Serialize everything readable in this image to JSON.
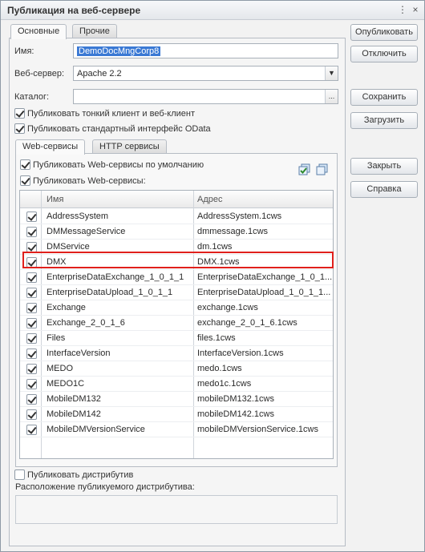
{
  "window": {
    "title": "Публикация на веб-сервере",
    "close_glyph": "×"
  },
  "tabs": [
    {
      "label": "Основные",
      "active": true
    },
    {
      "label": "Прочие",
      "active": false
    }
  ],
  "form": {
    "name_label": "Имя:",
    "name_value": "DemoDocMngCorp8",
    "server_label": "Веб-сервер:",
    "server_value": "Apache 2.2",
    "catalog_label": "Каталог:",
    "catalog_value": "",
    "catalog_btn": "...",
    "chk_thin_client": {
      "label": "Публиковать тонкий клиент и веб-клиент",
      "checked": true
    },
    "chk_odata": {
      "label": "Публиковать стандартный интерфейс OData",
      "checked": true
    }
  },
  "inner_tabs": [
    {
      "label": "Web-сервисы",
      "active": true
    },
    {
      "label": "HTTP сервисы",
      "active": false
    }
  ],
  "ws": {
    "chk_default": {
      "label": "Публиковать Web-сервисы по умолчанию",
      "checked": true
    },
    "chk_publish": {
      "label": "Публиковать Web-сервисы:",
      "checked": true
    },
    "columns": {
      "name": "Имя",
      "address": "Адрес"
    },
    "rows": [
      {
        "name": "AddressSystem",
        "address": "AddressSystem.1cws",
        "checked": true
      },
      {
        "name": "DMMessageService",
        "address": "dmmessage.1cws",
        "checked": true
      },
      {
        "name": "DMService",
        "address": "dm.1cws",
        "checked": true
      },
      {
        "name": "DMX",
        "address": "DMX.1cws",
        "checked": true
      },
      {
        "name": "EnterpriseDataExchange_1_0_1_1",
        "address": "EnterpriseDataExchange_1_0_1...",
        "checked": true
      },
      {
        "name": "EnterpriseDataUpload_1_0_1_1",
        "address": "EnterpriseDataUpload_1_0_1_1...",
        "checked": true
      },
      {
        "name": "Exchange",
        "address": "exchange.1cws",
        "checked": true
      },
      {
        "name": "Exchange_2_0_1_6",
        "address": "exchange_2_0_1_6.1cws",
        "checked": true
      },
      {
        "name": "Files",
        "address": "files.1cws",
        "checked": true
      },
      {
        "name": "InterfaceVersion",
        "address": "InterfaceVersion.1cws",
        "checked": true
      },
      {
        "name": "MEDO",
        "address": "medo.1cws",
        "checked": true
      },
      {
        "name": "MEDO1C",
        "address": "medo1c.1cws",
        "checked": true
      },
      {
        "name": "MobileDM132",
        "address": "mobileDM132.1cws",
        "checked": true
      },
      {
        "name": "MobileDM142",
        "address": "mobileDM142.1cws",
        "checked": true
      },
      {
        "name": "MobileDMVersionService",
        "address": "mobileDMVersionService.1cws",
        "checked": true
      }
    ]
  },
  "distrib": {
    "chk": {
      "label": "Публиковать дистрибутив",
      "checked": false
    },
    "location_label": "Расположение публикуемого дистрибутива:"
  },
  "buttons": {
    "publish": "Опубликовать",
    "disable": "Отключить",
    "save": "Сохранить",
    "load": "Загрузить",
    "close": "Закрыть",
    "help": "Справка"
  },
  "colors": {
    "highlight": "#e0201c",
    "selection": "#3a79d4"
  }
}
